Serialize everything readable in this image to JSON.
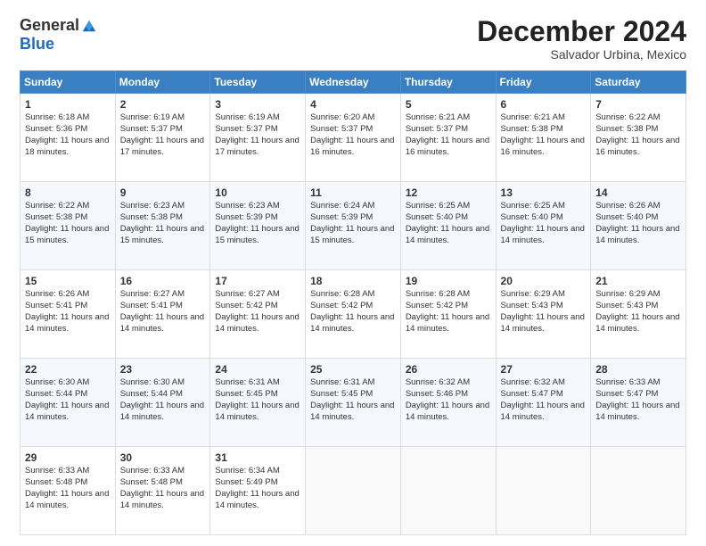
{
  "logo": {
    "general": "General",
    "blue": "Blue"
  },
  "title": "December 2024",
  "subtitle": "Salvador Urbina, Mexico",
  "days": [
    "Sunday",
    "Monday",
    "Tuesday",
    "Wednesday",
    "Thursday",
    "Friday",
    "Saturday"
  ],
  "weeks": [
    [
      {
        "day": "1",
        "sunrise": "6:18 AM",
        "sunset": "5:36 PM",
        "daylight": "11 hours and 18 minutes."
      },
      {
        "day": "2",
        "sunrise": "6:19 AM",
        "sunset": "5:37 PM",
        "daylight": "11 hours and 17 minutes."
      },
      {
        "day": "3",
        "sunrise": "6:19 AM",
        "sunset": "5:37 PM",
        "daylight": "11 hours and 17 minutes."
      },
      {
        "day": "4",
        "sunrise": "6:20 AM",
        "sunset": "5:37 PM",
        "daylight": "11 hours and 16 minutes."
      },
      {
        "day": "5",
        "sunrise": "6:21 AM",
        "sunset": "5:37 PM",
        "daylight": "11 hours and 16 minutes."
      },
      {
        "day": "6",
        "sunrise": "6:21 AM",
        "sunset": "5:38 PM",
        "daylight": "11 hours and 16 minutes."
      },
      {
        "day": "7",
        "sunrise": "6:22 AM",
        "sunset": "5:38 PM",
        "daylight": "11 hours and 16 minutes."
      }
    ],
    [
      {
        "day": "8",
        "sunrise": "6:22 AM",
        "sunset": "5:38 PM",
        "daylight": "11 hours and 15 minutes."
      },
      {
        "day": "9",
        "sunrise": "6:23 AM",
        "sunset": "5:38 PM",
        "daylight": "11 hours and 15 minutes."
      },
      {
        "day": "10",
        "sunrise": "6:23 AM",
        "sunset": "5:39 PM",
        "daylight": "11 hours and 15 minutes."
      },
      {
        "day": "11",
        "sunrise": "6:24 AM",
        "sunset": "5:39 PM",
        "daylight": "11 hours and 15 minutes."
      },
      {
        "day": "12",
        "sunrise": "6:25 AM",
        "sunset": "5:40 PM",
        "daylight": "11 hours and 14 minutes."
      },
      {
        "day": "13",
        "sunrise": "6:25 AM",
        "sunset": "5:40 PM",
        "daylight": "11 hours and 14 minutes."
      },
      {
        "day": "14",
        "sunrise": "6:26 AM",
        "sunset": "5:40 PM",
        "daylight": "11 hours and 14 minutes."
      }
    ],
    [
      {
        "day": "15",
        "sunrise": "6:26 AM",
        "sunset": "5:41 PM",
        "daylight": "11 hours and 14 minutes."
      },
      {
        "day": "16",
        "sunrise": "6:27 AM",
        "sunset": "5:41 PM",
        "daylight": "11 hours and 14 minutes."
      },
      {
        "day": "17",
        "sunrise": "6:27 AM",
        "sunset": "5:42 PM",
        "daylight": "11 hours and 14 minutes."
      },
      {
        "day": "18",
        "sunrise": "6:28 AM",
        "sunset": "5:42 PM",
        "daylight": "11 hours and 14 minutes."
      },
      {
        "day": "19",
        "sunrise": "6:28 AM",
        "sunset": "5:42 PM",
        "daylight": "11 hours and 14 minutes."
      },
      {
        "day": "20",
        "sunrise": "6:29 AM",
        "sunset": "5:43 PM",
        "daylight": "11 hours and 14 minutes."
      },
      {
        "day": "21",
        "sunrise": "6:29 AM",
        "sunset": "5:43 PM",
        "daylight": "11 hours and 14 minutes."
      }
    ],
    [
      {
        "day": "22",
        "sunrise": "6:30 AM",
        "sunset": "5:44 PM",
        "daylight": "11 hours and 14 minutes."
      },
      {
        "day": "23",
        "sunrise": "6:30 AM",
        "sunset": "5:44 PM",
        "daylight": "11 hours and 14 minutes."
      },
      {
        "day": "24",
        "sunrise": "6:31 AM",
        "sunset": "5:45 PM",
        "daylight": "11 hours and 14 minutes."
      },
      {
        "day": "25",
        "sunrise": "6:31 AM",
        "sunset": "5:45 PM",
        "daylight": "11 hours and 14 minutes."
      },
      {
        "day": "26",
        "sunrise": "6:32 AM",
        "sunset": "5:46 PM",
        "daylight": "11 hours and 14 minutes."
      },
      {
        "day": "27",
        "sunrise": "6:32 AM",
        "sunset": "5:47 PM",
        "daylight": "11 hours and 14 minutes."
      },
      {
        "day": "28",
        "sunrise": "6:33 AM",
        "sunset": "5:47 PM",
        "daylight": "11 hours and 14 minutes."
      }
    ],
    [
      {
        "day": "29",
        "sunrise": "6:33 AM",
        "sunset": "5:48 PM",
        "daylight": "11 hours and 14 minutes."
      },
      {
        "day": "30",
        "sunrise": "6:33 AM",
        "sunset": "5:48 PM",
        "daylight": "11 hours and 14 minutes."
      },
      {
        "day": "31",
        "sunrise": "6:34 AM",
        "sunset": "5:49 PM",
        "daylight": "11 hours and 14 minutes."
      },
      null,
      null,
      null,
      null
    ]
  ],
  "labels": {
    "sunrise": "Sunrise:",
    "sunset": "Sunset:",
    "daylight": "Daylight:"
  }
}
